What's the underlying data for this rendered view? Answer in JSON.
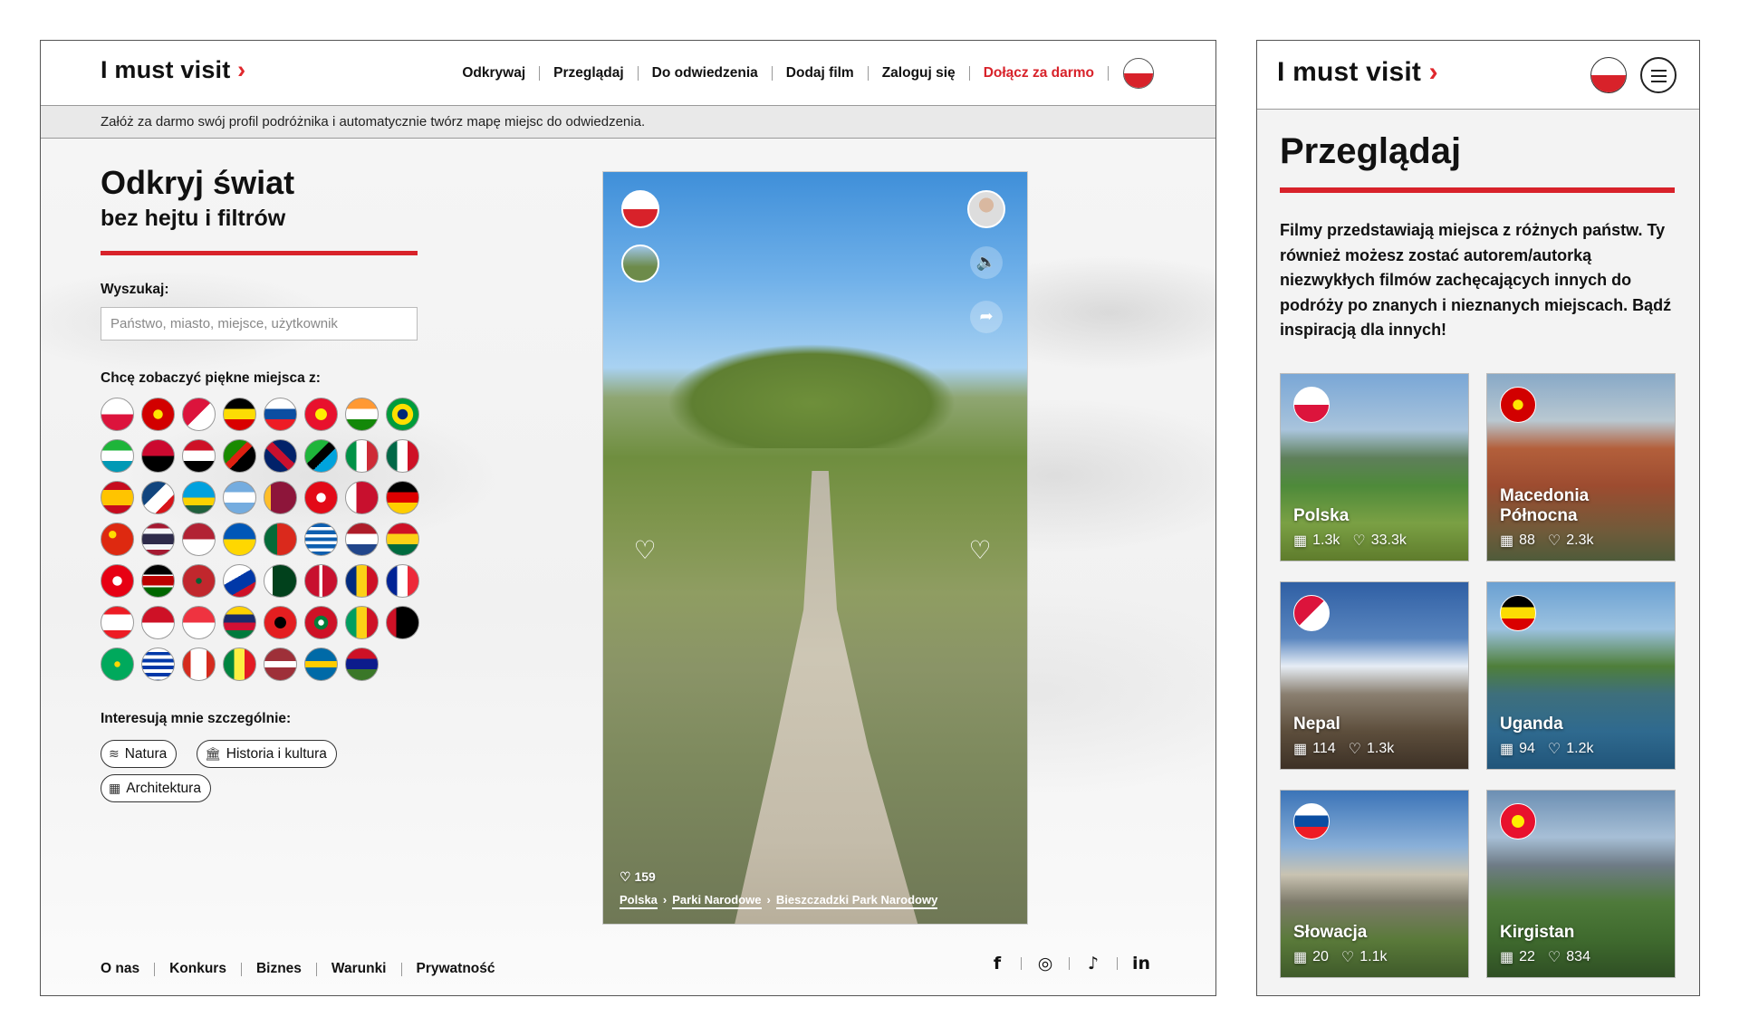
{
  "logo": {
    "text": "I must visit",
    "chevron": "›"
  },
  "desktop": {
    "nav": [
      {
        "label": "Odkrywaj"
      },
      {
        "label": "Przeglądaj"
      },
      {
        "label": "Do odwiedzenia"
      },
      {
        "label": "Dodaj film"
      },
      {
        "label": "Zaloguj się"
      },
      {
        "label": "Dołącz za darmo"
      }
    ],
    "banner": "Załóż za darmo swój profil podróżnika i automatycznie twórz mapę miejsc do odwiedzenia.",
    "hero": {
      "title": "Odkryj świat",
      "subtitle": "bez hejtu i filtrów"
    },
    "search": {
      "label": "Wyszukaj:",
      "placeholder": "Państwo, miasto, miejsce, użytkownik"
    },
    "flags_label": "Chcę zobaczyć piękne miejsca z:",
    "interests_label": "Interesują mnie szczególnie:",
    "interests": [
      {
        "label": "Natura",
        "icon": "waves-icon"
      },
      {
        "label": "Historia i kultura",
        "icon": "museum-icon"
      },
      {
        "label": "Architektura",
        "icon": "building-icon"
      }
    ],
    "video": {
      "likes": "159",
      "breadcrumb": [
        "Polska",
        "Parki Narodowe",
        "Bieszczadzki Park Narodowy"
      ]
    },
    "footer": [
      "O nas",
      "Konkurs",
      "Biznes",
      "Warunki",
      "Prywatność"
    ],
    "social": [
      "f",
      "◎",
      "♪",
      "in"
    ]
  },
  "mobile": {
    "title": "Przeglądaj",
    "description": "Filmy przedstawiają miejsca z różnych państw. Ty również możesz zostać autorem/autorką niezwykłych filmów zachęcających innych do podróży po znanych i nieznanych miejscach. Bądź inspiracją dla innych!",
    "cards": [
      {
        "name": "Polska",
        "videos": "1.3k",
        "likes": "33.3k"
      },
      {
        "name": "Macedonia Północna",
        "videos": "88",
        "likes": "2.3k"
      },
      {
        "name": "Nepal",
        "videos": "114",
        "likes": "1.3k"
      },
      {
        "name": "Uganda",
        "videos": "94",
        "likes": "1.2k"
      },
      {
        "name": "Słowacja",
        "videos": "20",
        "likes": "1.1k"
      },
      {
        "name": "Kirgistan",
        "videos": "22",
        "likes": "834"
      }
    ]
  },
  "colors": {
    "accent": "#d8222a"
  }
}
